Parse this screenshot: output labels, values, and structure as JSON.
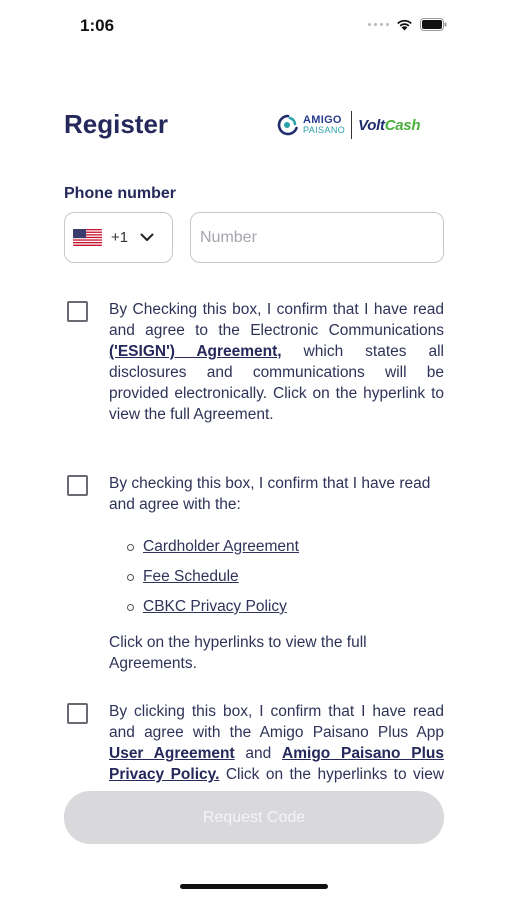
{
  "status_bar": {
    "time": "1:06"
  },
  "header": {
    "title": "Register",
    "logo_amigo_line1": "AMIGO",
    "logo_amigo_line2": "PAISANO",
    "logo_volt": "Volt",
    "logo_cash": "Cash"
  },
  "phone": {
    "label": "Phone number",
    "country_code": "+1",
    "number_placeholder": "Number",
    "number_value": ""
  },
  "consents": [
    {
      "checked": false,
      "text_before": "By Checking this box, I confirm that I have read and agree to the Electronic Communications ",
      "link": "('ESIGN') Agreement,",
      "text_after": " which states all disclosures and communications will be provided electronically. Click on the hyperlink to view the full Agreement."
    },
    {
      "checked": false,
      "text": "By checking this box, I confirm that I have read and agree with the:",
      "links": [
        "Cardholder Agreement",
        "Fee Schedule",
        "CBKC Privacy Policy"
      ],
      "footer": "Click on the hyperlinks to view the full Agreements."
    },
    {
      "checked": false,
      "text_before": "By clicking this box, I confirm that I have read and agree with the Amigo Paisano Plus App ",
      "link1": "User Agreement",
      "text_middle": " and ",
      "link2": "Amigo Paisano Plus Privacy Policy.",
      "text_after": " Click on the hyperlinks to view the full Agreements."
    }
  ],
  "actions": {
    "request_code": "Request Code"
  },
  "colors": {
    "primary_text": "#25285a",
    "button_disabled": "#d9d9db",
    "brand_green": "#4cae3f",
    "brand_teal": "#2aa2a8"
  }
}
